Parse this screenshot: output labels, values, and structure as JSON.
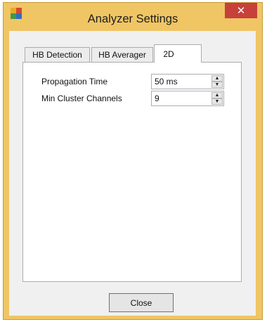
{
  "window": {
    "title": "Analyzer Settings",
    "close_glyph": "✕",
    "app_icon": "analyzer-app-icon",
    "accent_color": "#f0c564",
    "close_color": "#c7413b"
  },
  "tabs": [
    {
      "label": "HB Detection",
      "active": false
    },
    {
      "label": "HB Averager",
      "active": false
    },
    {
      "label": "2D",
      "active": true
    }
  ],
  "fields": [
    {
      "label": "Propagation Time",
      "value": "50 ms"
    },
    {
      "label": "Min Cluster Channels",
      "value": "9"
    }
  ],
  "footer": {
    "close_label": "Close"
  }
}
